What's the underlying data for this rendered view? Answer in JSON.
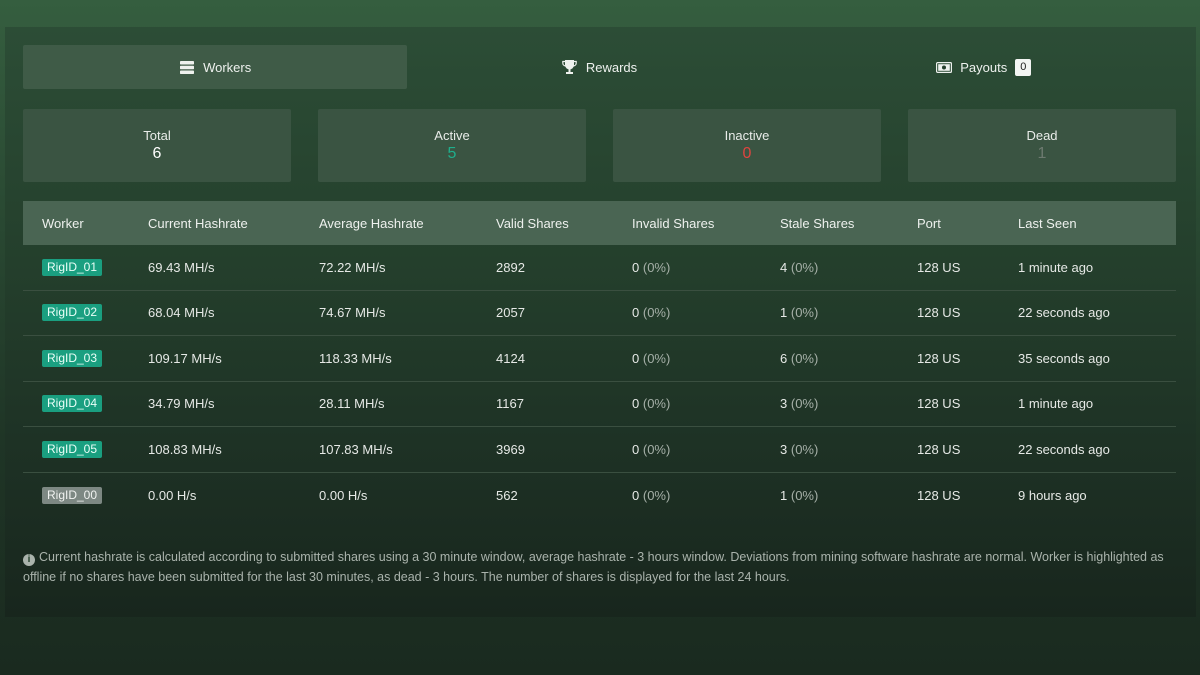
{
  "tabs": [
    {
      "label": "Workers",
      "icon": "server-icon",
      "active": true
    },
    {
      "label": "Rewards",
      "icon": "trophy-icon",
      "active": false
    },
    {
      "label": "Payouts",
      "icon": "money-icon",
      "active": false,
      "count": "0"
    }
  ],
  "stats": [
    {
      "label": "Total",
      "value": "6",
      "color": "#ffffff"
    },
    {
      "label": "Active",
      "value": "5",
      "color": "#1fae8c"
    },
    {
      "label": "Inactive",
      "value": "0",
      "color": "#e0443f"
    },
    {
      "label": "Dead",
      "value": "1",
      "color": "#6d7a70"
    }
  ],
  "table": {
    "headers": [
      "Worker",
      "Current Hashrate",
      "Average Hashrate",
      "Valid Shares",
      "Invalid Shares",
      "Stale Shares",
      "Port",
      "Last Seen"
    ],
    "rows": [
      {
        "worker": "RigID_01",
        "status": "active",
        "current": "69.43 MH/s",
        "average": "72.22 MH/s",
        "valid": "2892",
        "invalid": "0",
        "invalid_pct": "(0%)",
        "stale": "4",
        "stale_pct": "(0%)",
        "port": "128 US",
        "last_seen": "1 minute ago"
      },
      {
        "worker": "RigID_02",
        "status": "active",
        "current": "68.04 MH/s",
        "average": "74.67 MH/s",
        "valid": "2057",
        "invalid": "0",
        "invalid_pct": "(0%)",
        "stale": "1",
        "stale_pct": "(0%)",
        "port": "128 US",
        "last_seen": "22 seconds ago"
      },
      {
        "worker": "RigID_03",
        "status": "active",
        "current": "109.17 MH/s",
        "average": "118.33 MH/s",
        "valid": "4124",
        "invalid": "0",
        "invalid_pct": "(0%)",
        "stale": "6",
        "stale_pct": "(0%)",
        "port": "128 US",
        "last_seen": "35 seconds ago"
      },
      {
        "worker": "RigID_04",
        "status": "active",
        "current": "34.79 MH/s",
        "average": "28.11 MH/s",
        "valid": "1167",
        "invalid": "0",
        "invalid_pct": "(0%)",
        "stale": "3",
        "stale_pct": "(0%)",
        "port": "128 US",
        "last_seen": "1 minute ago"
      },
      {
        "worker": "RigID_05",
        "status": "active",
        "current": "108.83 MH/s",
        "average": "107.83 MH/s",
        "valid": "3969",
        "invalid": "0",
        "invalid_pct": "(0%)",
        "stale": "3",
        "stale_pct": "(0%)",
        "port": "128 US",
        "last_seen": "22 seconds ago"
      },
      {
        "worker": "RigID_00",
        "status": "dead",
        "current": "0.00 H/s",
        "average": "0.00 H/s",
        "valid": "562",
        "invalid": "0",
        "invalid_pct": "(0%)",
        "stale": "1",
        "stale_pct": "(0%)",
        "port": "128 US",
        "last_seen": "9 hours ago"
      }
    ]
  },
  "note": {
    "icon": "info-icon",
    "text": "Current hashrate is calculated according to submitted shares using a 30 minute window, average hashrate - 3 hours window. Deviations from mining software hashrate are normal. Worker is highlighted as offline if no shares have been submitted for the last 30 minutes, as dead - 3 hours. The number of shares is displayed for the last 24 hours."
  },
  "colors": {
    "accent": "#1a9f80",
    "active_tab_bg": "#3f5b47",
    "card_bg": "#3a5442",
    "header_bg": "#4a6553"
  }
}
